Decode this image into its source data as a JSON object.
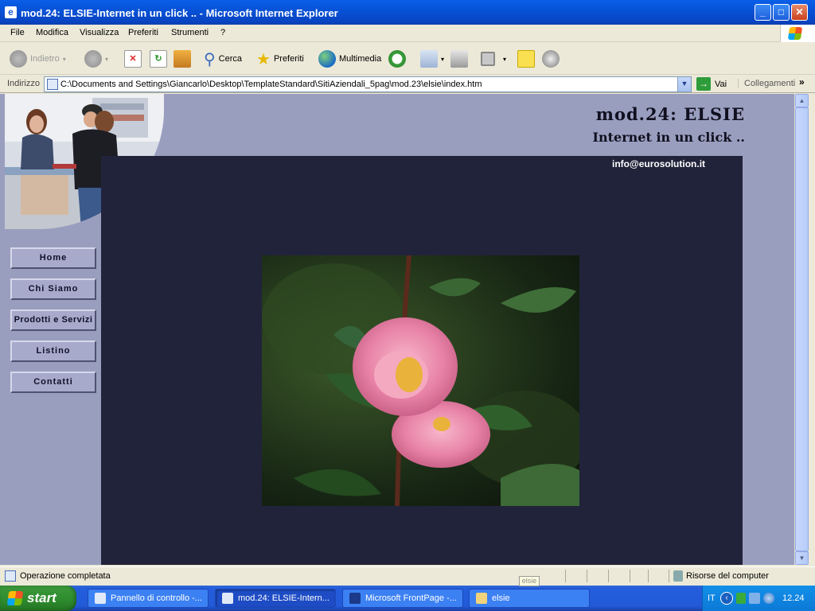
{
  "window": {
    "title": "mod.24: ELSIE-Internet in un click .. - Microsoft Internet Explorer",
    "controls": [
      "minimize",
      "maximize",
      "close"
    ]
  },
  "menu": [
    "File",
    "Modifica",
    "Visualizza",
    "Preferiti",
    "Strumenti",
    "?"
  ],
  "toolbar": {
    "back": "Indietro",
    "search": "Cerca",
    "favorites": "Preferiti",
    "media": "Multimedia"
  },
  "address": {
    "label": "Indirizzo",
    "value": "C:\\Documents and Settings\\Giancarlo\\Desktop\\TemplateStandard\\SitiAziendali_5pag\\mod.23\\elsie\\index.htm",
    "go": "Vai",
    "links": "Collegamenti"
  },
  "page": {
    "title": "mod.24: ELSIE",
    "subtitle": "Internet in un click ..",
    "email": "info@eurosolution.it",
    "nav": [
      "Home",
      "Chi Siamo",
      "Prodotti e Servizi",
      "Listino",
      "Contatti"
    ]
  },
  "status": {
    "text": "Operazione completata",
    "zone": "Risorse del computer"
  },
  "taskbar": {
    "start": "start",
    "tasks": [
      "Pannello di controllo -...",
      "mod.24: ELSIE-Intern...",
      "Microsoft FrontPage -...",
      "elsie"
    ],
    "tooltip": "elsie",
    "lang": "IT",
    "clock": "12.24"
  },
  "colors": {
    "page_bg": "#9A9EBE",
    "dark_panel": "#21233A",
    "nav_button": "#A7AACB"
  }
}
